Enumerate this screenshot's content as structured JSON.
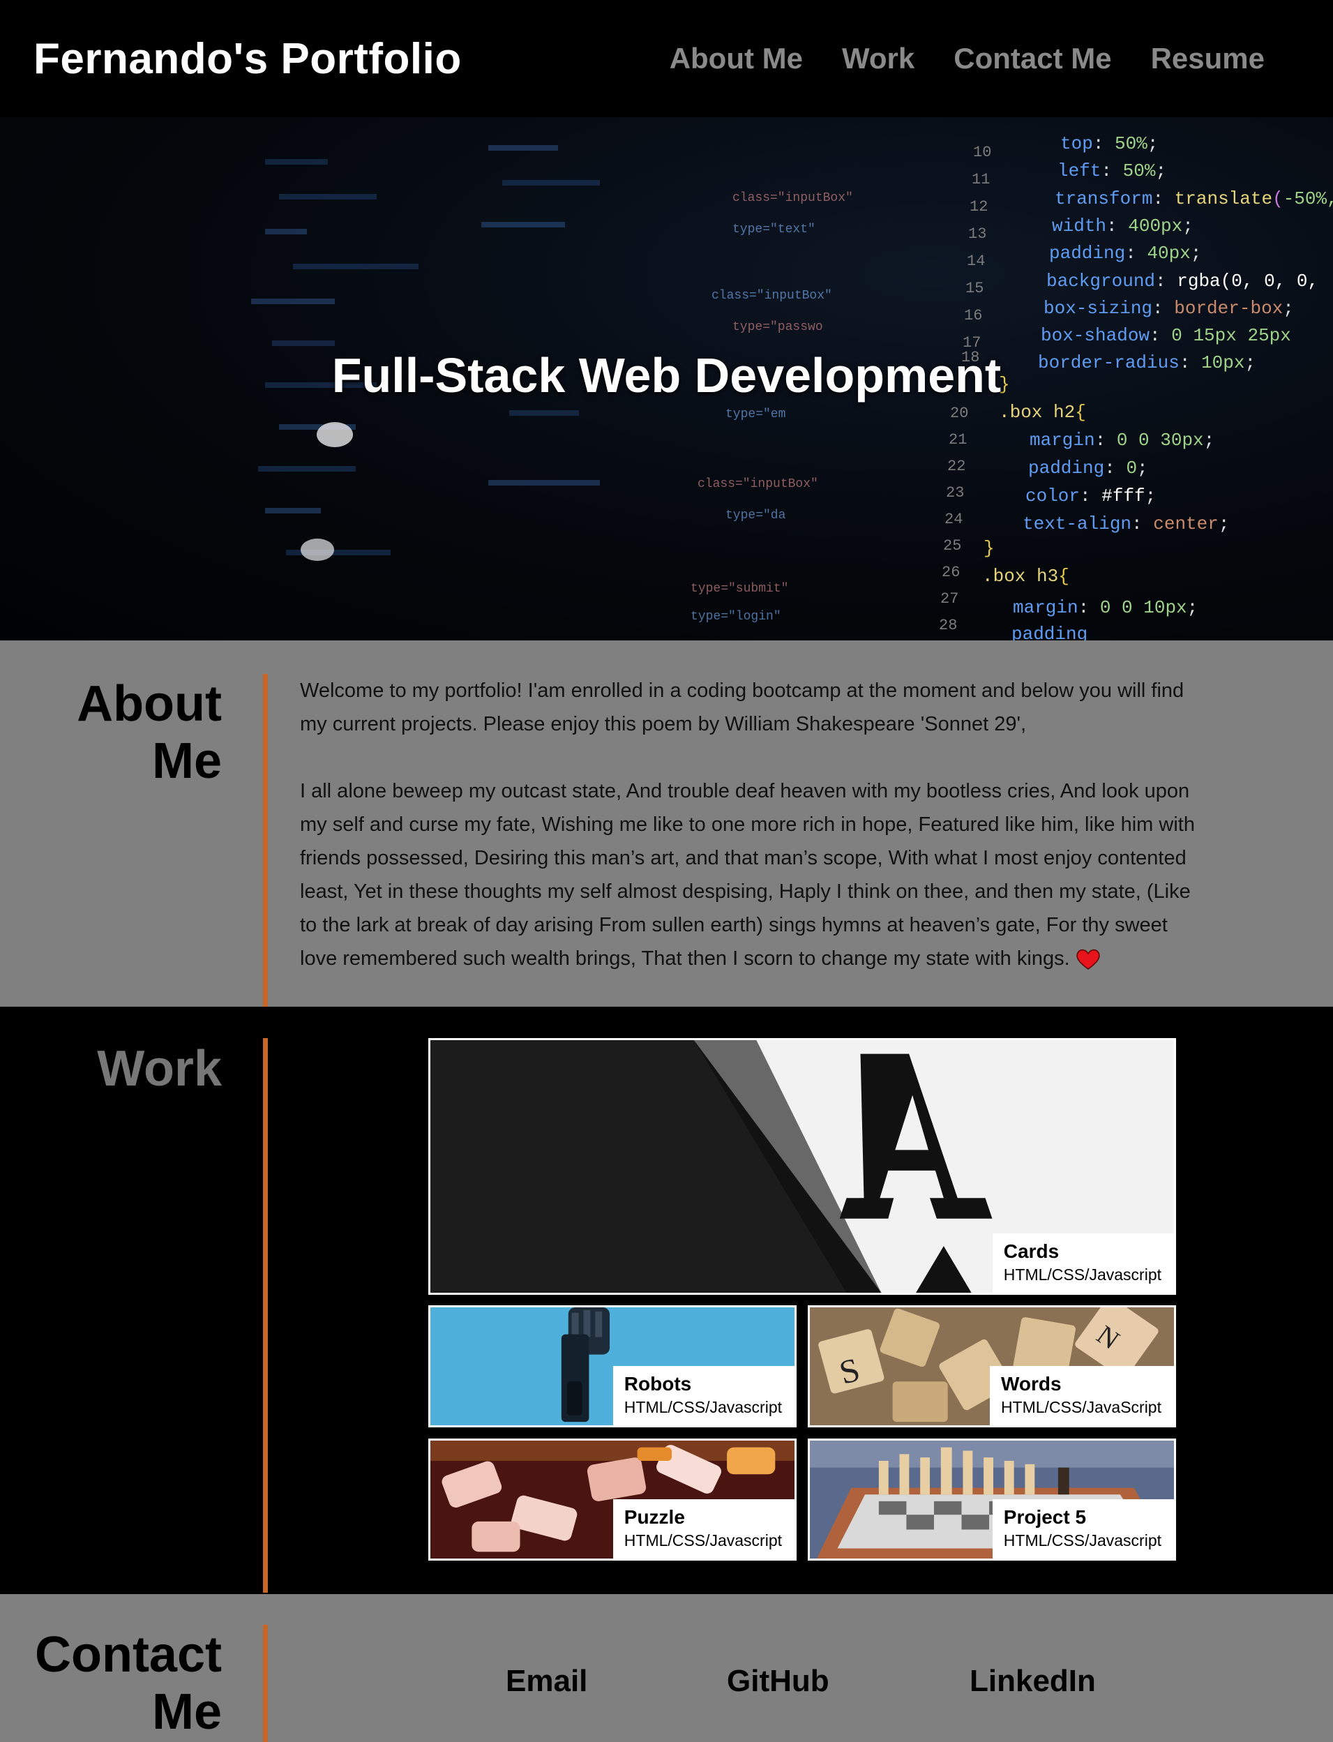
{
  "header": {
    "brand": "Fernando's Portfolio",
    "nav": [
      "About Me",
      "Work",
      "Contact Me",
      "Resume"
    ]
  },
  "hero": {
    "title": "Full-Stack Web Development"
  },
  "about": {
    "title_line1": "About",
    "title_line2": "Me",
    "intro": "Welcome to my portfolio! I'am enrolled in a coding bootcamp at the moment and below you will find my current projects. Please enjoy this poem by William Shakespeare 'Sonnet 29',",
    "poem": "I all alone beweep my outcast state, And trouble deaf heaven with my bootless cries, And look upon my self and curse my fate, Wishing me like to one more rich in hope, Featured like him, like him with friends possessed, Desiring this man’s art, and that man’s scope, With what I most enjoy contented least, Yet in these thoughts my self almost despising, Haply I think on thee, and then my state, (Like to the lark at break of day arising From sullen earth) sings hymns at heaven’s gate, For thy sweet love remembered such wealth brings, That then I scorn to change my state with kings."
  },
  "work": {
    "title": "Work",
    "projects": [
      {
        "name": "Cards",
        "tech": "HTML/CSS/Javascript"
      },
      {
        "name": "Robots",
        "tech": "HTML/CSS/Javascript"
      },
      {
        "name": "Words",
        "tech": "HTML/CSS/JavaScript"
      },
      {
        "name": "Puzzle",
        "tech": "HTML/CSS/Javascript"
      },
      {
        "name": "Project 5",
        "tech": "HTML/CSS/Javascript"
      }
    ]
  },
  "contact": {
    "title_line1": "Contact",
    "title_line2": "Me",
    "links": [
      "Email",
      "GitHub",
      "LinkedIn"
    ]
  },
  "code_snippet": {
    "line_numbers": [
      "10",
      "11",
      "12",
      "13",
      "14",
      "15",
      "16",
      "17",
      "18",
      "19",
      "20",
      "21",
      "22",
      "23",
      "24",
      "25",
      "26",
      "27",
      "28"
    ],
    "lines": [
      "top: 50%;",
      "left: 50%;",
      "transform: translate(-50%,",
      "width: 400px;",
      "padding: 40px;",
      "background: rgba(0, 0, 0,",
      "box-sizing: border-box;",
      "box-shadow: 0 15px 25px",
      "border-radius: 10px;",
      "}",
      ".box h2{",
      "margin: 0 0 30px;",
      "padding: 0;",
      "color: #fff;",
      "text-align: center;",
      "}",
      ".box h3{",
      "margin: 0 0 10px;",
      "padding"
    ]
  }
}
